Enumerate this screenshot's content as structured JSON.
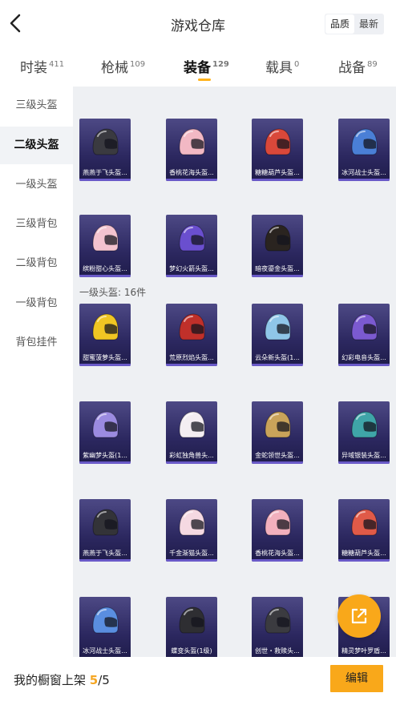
{
  "header": {
    "title": "游戏仓库",
    "segment": {
      "quality": "品质",
      "latest": "最新"
    }
  },
  "tabs": [
    {
      "label": "时装",
      "count": "411"
    },
    {
      "label": "枪械",
      "count": "109"
    },
    {
      "label": "装备",
      "count": "129"
    },
    {
      "label": "载具",
      "count": "0"
    },
    {
      "label": "战备",
      "count": "89"
    }
  ],
  "sidebar": [
    {
      "label": "三级头盔"
    },
    {
      "label": "二级头盔"
    },
    {
      "label": "一级头盔"
    },
    {
      "label": "三级背包"
    },
    {
      "label": "二级背包"
    },
    {
      "label": "一级背包"
    },
    {
      "label": "背包挂件"
    }
  ],
  "section_label": "一级头盔: 16件",
  "items": [
    {
      "name": "燕燕于飞头盔...",
      "color": "#3a3a40"
    },
    {
      "name": "香桃花海头盔...",
      "color": "#f2b8c4"
    },
    {
      "name": "糖糖葫芦头盔...",
      "color": "#d9483a"
    },
    {
      "name": "冰河战士头盔...",
      "color": "#4a7fd6"
    },
    {
      "name": "缤粉甜心头盔...",
      "color": "#f3c3cf"
    },
    {
      "name": "梦幻火箭头盔...",
      "color": "#6a4fcf"
    },
    {
      "name": "暗夜鎏金头盔...",
      "color": "#2a2420"
    },
    {
      "name": "甜蜜菠萝头盔...",
      "color": "#f0c623"
    },
    {
      "name": "荒原烈焰头盔...",
      "color": "#c0302a"
    },
    {
      "name": "云朵新头盔(1...",
      "color": "#8fc6e8"
    },
    {
      "name": "幻彩电音头盔...",
      "color": "#7b5ad0"
    },
    {
      "name": "紫幽梦头盔(1...",
      "color": "#9b8be0"
    },
    {
      "name": "彩虹独角兽头...",
      "color": "#f4eef2"
    },
    {
      "name": "金蛇领世头盔...",
      "color": "#c9a35a"
    },
    {
      "name": "异域银装头盔...",
      "color": "#3fa5a8"
    },
    {
      "name": "燕燕于飞头盔...",
      "color": "#333338"
    },
    {
      "name": "千金渐猫头盔...",
      "color": "#f5d9e2"
    },
    {
      "name": "香桃花海头盔...",
      "color": "#f2b0bd"
    },
    {
      "name": "糖糖葫芦头盔...",
      "color": "#e05a48"
    },
    {
      "name": "冰河战士头盔...",
      "color": "#5a8ee0"
    },
    {
      "name": "蝶变头盔(1级)",
      "color": "#2e2e32"
    },
    {
      "name": "创世・救赎头...",
      "color": "#3b3b40"
    },
    {
      "name": "精灵梦叶罗盾...",
      "color": "#7a6ad8"
    }
  ],
  "bottom": {
    "prefix": "我的橱窗上架 ",
    "current": "5",
    "total": "/5",
    "edit_label": "编辑"
  }
}
